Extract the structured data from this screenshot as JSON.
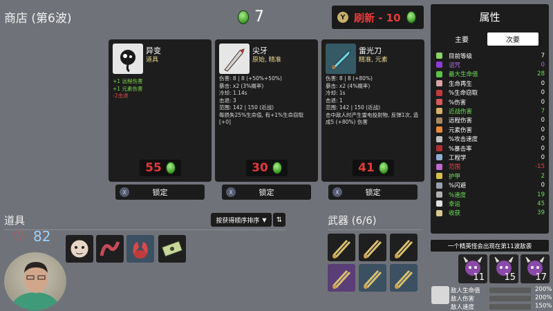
{
  "header": {
    "shop_title": "商店 (第6波)",
    "gold": "7",
    "reroll_button": "Y",
    "reroll_label": "刷新 - 10"
  },
  "shop_cards": [
    {
      "name": "异变",
      "subtitle": "道具",
      "stats": [
        "+1 远程伤害",
        "+1 元素伤害",
        "-2击退"
      ],
      "price": "55",
      "lock_label": "锁定"
    },
    {
      "name": "尖牙",
      "subtitle": "原始, 精准",
      "stats": [
        "伤害: 8 | 8 (+50%+50%)",
        "暴击: x2 (3%概率)",
        "冷却: 1.14s",
        "击退: 3",
        "范围: 142 | 150 (近战)",
        "每损失25%生命值, 有+1%生命窃取[+0]"
      ],
      "price": "30",
      "lock_label": "锁定"
    },
    {
      "name": "雷光刀",
      "subtitle": "精准, 元素",
      "stats": [
        "伤害: 8 | 8 (+80%)",
        "暴击: x2 (4%概率)",
        "冷却: 1s",
        "击退: 1",
        "范围: 142 | 150 (近战)",
        "击中敌人时产生雷电投射物, 反弹1次, 造成5 (+80%) 伤害"
      ],
      "price": "41",
      "lock_label": "锁定"
    }
  ],
  "items_section": {
    "title": "道具",
    "health": "82",
    "sort_label": "按获得顺序排序"
  },
  "weapons_section": {
    "title": "武器 (6/6)"
  },
  "stats_panel": {
    "title": "属性",
    "tab_primary": "主要",
    "tab_secondary": "次要",
    "rows": [
      {
        "name": "目前等级",
        "value": "7",
        "color": "#ffffff",
        "icon": "#88d46a"
      },
      {
        "name": "诅咒",
        "value": "0",
        "color": "#b46ee8",
        "icon": "#8f3ad6"
      },
      {
        "name": "最大生命值",
        "value": "28",
        "color": "#6fe05a",
        "icon": "#59c447"
      },
      {
        "name": "生命再生",
        "value": "0",
        "color": "#ffffff",
        "icon": "#d9a2a2"
      },
      {
        "name": "%生命窃取",
        "value": "0",
        "color": "#ffffff",
        "icon": "#c23a3a"
      },
      {
        "name": "%伤害",
        "value": "0",
        "color": "#ffffff",
        "icon": "#d65a5a"
      },
      {
        "name": "近战伤害",
        "value": "7",
        "color": "#6fe05a",
        "icon": "#d9b06a"
      },
      {
        "name": "远程伤害",
        "value": "0",
        "color": "#ffffff",
        "icon": "#a88860"
      },
      {
        "name": "元素伤害",
        "value": "0",
        "color": "#ffffff",
        "icon": "#e8883a"
      },
      {
        "name": "%攻击速度",
        "value": "0",
        "color": "#ffffff",
        "icon": "#c0c0c0"
      },
      {
        "name": "%暴击率",
        "value": "0",
        "color": "#ffffff",
        "icon": "#b03030"
      },
      {
        "name": "工程学",
        "value": "0",
        "color": "#ffffff",
        "icon": "#8fb0d0"
      },
      {
        "name": "范围",
        "value": "-15",
        "color": "#e04848",
        "icon": "#c06ad0"
      },
      {
        "name": "护甲",
        "value": "2",
        "color": "#6fe05a",
        "icon": "#d8c04a"
      },
      {
        "name": "%闪避",
        "value": "0",
        "color": "#ffffff",
        "icon": "#9aa0b0"
      },
      {
        "name": "%速度",
        "value": "19",
        "color": "#6fe05a",
        "icon": "#b0b0b0"
      },
      {
        "name": "幸运",
        "value": "45",
        "color": "#6fe05a",
        "icon": "#e0e0e0"
      },
      {
        "name": "收获",
        "value": "39",
        "color": "#6fe05a",
        "icon": "#d8c890"
      }
    ]
  },
  "elite_notice": "一个精英怪会出现在第11波敌袭",
  "enemy_waves": [
    "11",
    "15",
    "17"
  ],
  "enemy_stats": [
    {
      "label": "敌人生命值",
      "value": "200%"
    },
    {
      "label": "敌人伤害",
      "value": "200%"
    },
    {
      "label": "敌人速度",
      "value": "150%"
    }
  ]
}
